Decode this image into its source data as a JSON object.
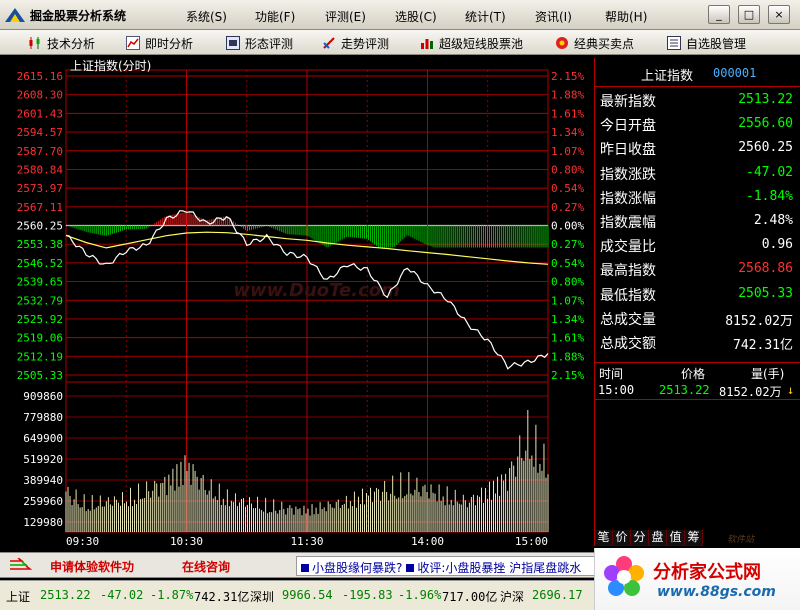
{
  "app": {
    "title": "掘金股票分析系统"
  },
  "menu": [
    {
      "label": "系统(S)"
    },
    {
      "label": "功能(F)"
    },
    {
      "label": "评测(E)"
    },
    {
      "label": "选股(C)"
    },
    {
      "label": "统计(T)"
    },
    {
      "label": "资讯(I)"
    },
    {
      "label": "帮助(H)"
    }
  ],
  "window_controls": {
    "minimize": "_",
    "maximize": "□",
    "close": "×"
  },
  "toolbar": [
    {
      "label": "技术分析",
      "icon": "candlestick-icon"
    },
    {
      "label": "即时分析",
      "icon": "line-chart-icon"
    },
    {
      "label": "形态评测",
      "icon": "pattern-icon"
    },
    {
      "label": "走势评测",
      "icon": "trend-icon"
    },
    {
      "label": "超级短线股票池",
      "icon": "stock-pool-icon"
    },
    {
      "label": "经典买卖点",
      "icon": "buy-sell-icon"
    },
    {
      "label": "自选股管理",
      "icon": "watchlist-icon"
    }
  ],
  "chart": {
    "title": "上证指数(分时)",
    "watermark": "www.DuoTe.com",
    "y_labels_left": [
      "2615.16",
      "2608.30",
      "2601.43",
      "2594.57",
      "2587.70",
      "2580.84",
      "2573.97",
      "2567.11",
      "2560.25",
      "2553.38",
      "2546.52",
      "2539.65",
      "2532.79",
      "2525.92",
      "2519.06",
      "2512.19",
      "2505.33"
    ],
    "y_labels_right": [
      "2.15%",
      "1.88%",
      "1.61%",
      "1.34%",
      "1.07%",
      "0.80%",
      "0.54%",
      "0.27%",
      "0.00%",
      "0.27%",
      "0.54%",
      "0.80%",
      "1.07%",
      "1.34%",
      "1.61%",
      "1.88%",
      "2.15%"
    ],
    "vol_labels": [
      "909860",
      "779880",
      "649900",
      "519920",
      "389940",
      "259960",
      "129980"
    ],
    "x_labels": [
      "09:30",
      "10:30",
      "11:30",
      "14:00",
      "15:00"
    ]
  },
  "chart_data": {
    "type": "line",
    "title": "上证指数(分时)",
    "xlabel": "",
    "ylabel": "",
    "ylim": [
      2505.33,
      2615.16
    ],
    "prev_close": 2560.25,
    "x": [
      "09:30",
      "09:40",
      "09:50",
      "10:00",
      "10:10",
      "10:20",
      "10:30",
      "10:40",
      "10:50",
      "11:00",
      "11:10",
      "11:20",
      "11:30",
      "13:10",
      "13:20",
      "13:30",
      "13:40",
      "13:50",
      "14:00",
      "14:10",
      "14:20",
      "14:30",
      "14:40",
      "14:50",
      "15:00"
    ],
    "series": [
      {
        "values": [
          2556.6,
          2550.0,
          2545.5,
          2551.0,
          2553.0,
          2562.5,
          2566.0,
          2561.0,
          2563.5,
          2553.5,
          2556.0,
          2550.0,
          2548.5,
          2540.0,
          2546.0,
          2544.0,
          2534.0,
          2545.0,
          2538.0,
          2533.0,
          2524.0,
          2518.0,
          2508.5,
          2510.0,
          2513.22
        ]
      },
      {
        "values": [
          2556.6,
          2554.0,
          2552.0,
          2553.5,
          2555.0,
          2556.5,
          2557.5,
          2557.8,
          2557.6,
          2557.0,
          2556.2,
          2555.4,
          2554.8,
          2553.8,
          2553.0,
          2552.4,
          2551.8,
          2551.0,
          2550.3,
          2549.6,
          2548.8,
          2548.0,
          2547.2,
          2546.5,
          2546.0
        ]
      }
    ],
    "volume_ylim": [
      0,
      1039840
    ],
    "volume": [
      400000,
      280000,
      300000,
      330000,
      410000,
      500000,
      680000,
      450000,
      340000,
      300000,
      260000,
      240000,
      220000,
      260000,
      300000,
      380000,
      430000,
      470000,
      420000,
      360000,
      300000,
      420000,
      560000,
      960000,
      640000
    ]
  },
  "quote": {
    "name": "上证指数",
    "code": "000001",
    "rows": [
      {
        "label": "最新指数",
        "value": "2513.22",
        "color": "#00ff00"
      },
      {
        "label": "今日开盘",
        "value": "2556.60",
        "color": "#00ff00"
      },
      {
        "label": "昨日收盘",
        "value": "2560.25",
        "color": "#ffffff"
      },
      {
        "label": "指数涨跌",
        "value": "-47.02",
        "color": "#00ff00"
      },
      {
        "label": "指数涨幅",
        "value": "-1.84%",
        "color": "#00ff00"
      },
      {
        "label": "指数震幅",
        "value": "2.48%",
        "color": "#ffffff"
      },
      {
        "label": "成交量比",
        "value": "0.96",
        "color": "#ffffff"
      },
      {
        "label": "最高指数",
        "value": "2568.86",
        "color": "#ff3030"
      },
      {
        "label": "最低指数",
        "value": "2505.33",
        "color": "#00ff00"
      },
      {
        "label": "总成交量",
        "value": "8152.02万",
        "color": "#ffffff"
      },
      {
        "label": "总成交额",
        "value": "742.31亿",
        "color": "#ffffff"
      }
    ]
  },
  "ticks": {
    "headers": {
      "time": "时间",
      "price": "价格",
      "volume": "量(手)"
    },
    "row": {
      "time": "15:00",
      "price": "2513.22",
      "volume": "8152.02万",
      "arrow": "↓"
    }
  },
  "panel_tabs": [
    "笔",
    "价",
    "分",
    "盘",
    "值",
    "筹"
  ],
  "panel_watermark": "软件站",
  "ticker": {
    "left1": "申请体验软件功",
    "left2": "在线咨询",
    "news1": "小盘股缘何暴跌?",
    "news2": "收评:小盘股暴挫 沪指尾盘跳水"
  },
  "status": [
    {
      "text": "上证",
      "color": "#000000"
    },
    {
      "text": "2513.22",
      "color": "#008000"
    },
    {
      "text": "-47.02",
      "color": "#008000"
    },
    {
      "text": "-1.87%",
      "color": "#008000"
    },
    {
      "text": "742.31亿",
      "color": "#000000"
    },
    {
      "text": "深圳",
      "color": "#000000"
    },
    {
      "text": "9966.54",
      "color": "#008000"
    },
    {
      "text": "-195.83",
      "color": "#008000"
    },
    {
      "text": "-1.96%",
      "color": "#008000"
    },
    {
      "text": "717.00亿",
      "color": "#000000"
    },
    {
      "text": "沪深",
      "color": "#000000"
    },
    {
      "text": "2696.17",
      "color": "#008000"
    },
    {
      "text": "-46.57",
      "color": "#008000"
    }
  ],
  "brand": {
    "name": "分析家公式网",
    "url": "www.88gs.com"
  }
}
